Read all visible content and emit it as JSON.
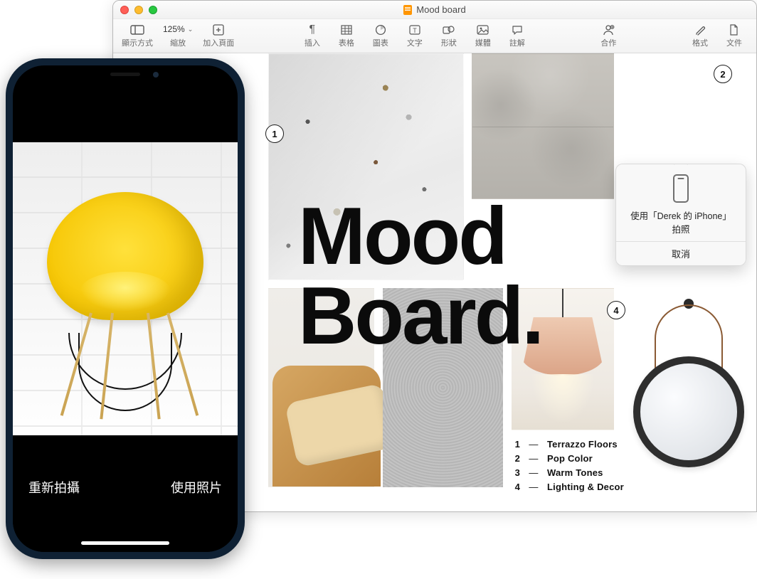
{
  "window": {
    "title": "Mood board"
  },
  "toolbar": {
    "view": "顯示方式",
    "zoom_label": "縮放",
    "zoom_value": "125%",
    "add_page": "加入頁面",
    "insert": "插入",
    "table": "表格",
    "chart": "圖表",
    "text": "文字",
    "shape": "形狀",
    "media": "媒體",
    "comment": "註解",
    "collaborate": "合作",
    "format": "格式",
    "document": "文件"
  },
  "moodboard": {
    "title_l1": "Mood",
    "title_l2": "Board."
  },
  "legend": [
    {
      "n": "1",
      "label": "Terrazzo Floors"
    },
    {
      "n": "2",
      "label": "Pop Color"
    },
    {
      "n": "3",
      "label": "Warm Tones"
    },
    {
      "n": "4",
      "label": "Lighting & Decor"
    }
  ],
  "markers": {
    "m1": "1",
    "m2": "2",
    "m4": "4"
  },
  "popover": {
    "line1": "使用「Derek 的 iPhone」",
    "line2": "拍照",
    "cancel": "取消"
  },
  "iphone": {
    "retake": "重新拍攝",
    "use_photo": "使用照片"
  }
}
